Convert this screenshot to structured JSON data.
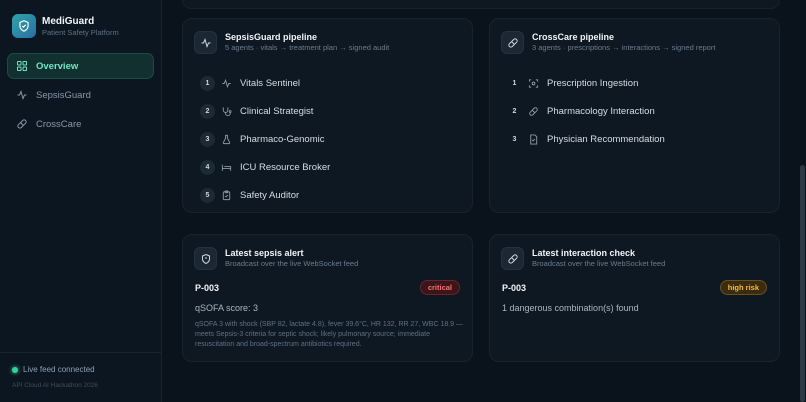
{
  "brand": {
    "name": "MediGuard",
    "subtitle": "Patient Safety Platform"
  },
  "nav": [
    {
      "label": "Overview",
      "icon": "grid-icon",
      "active": true
    },
    {
      "label": "SepsisGuard",
      "icon": "pulse-icon",
      "active": false
    },
    {
      "label": "CrossCare",
      "icon": "pill-icon",
      "active": false
    }
  ],
  "status": {
    "live": "Live feed connected",
    "footer": "API Cloud AI Hackathon 2026"
  },
  "sepsis_pipeline": {
    "title": "SepsisGuard pipeline",
    "subtitle": "5 agents · vitals → treatment plan → signed audit",
    "agents": [
      {
        "num": "1",
        "label": "Vitals Sentinel",
        "icon": "pulse-icon"
      },
      {
        "num": "2",
        "label": "Clinical Strategist",
        "icon": "stethoscope-icon"
      },
      {
        "num": "3",
        "label": "Pharmaco-Genomic",
        "icon": "flask-icon"
      },
      {
        "num": "4",
        "label": "ICU Resource Broker",
        "icon": "bed-icon"
      },
      {
        "num": "5",
        "label": "Safety Auditor",
        "icon": "clipboard-icon"
      }
    ]
  },
  "crosscare_pipeline": {
    "title": "CrossCare pipeline",
    "subtitle": "3 agents · prescriptions → interactions → signed report",
    "agents": [
      {
        "num": "1",
        "label": "Prescription Ingestion",
        "icon": "scan-icon"
      },
      {
        "num": "2",
        "label": "Pharmacology Interaction",
        "icon": "pill-icon"
      },
      {
        "num": "3",
        "label": "Physician Recommendation",
        "icon": "document-icon"
      }
    ]
  },
  "sepsis_alert": {
    "title": "Latest sepsis alert",
    "subtitle": "Broadcast over the live WebSocket feed",
    "patient": "P-003",
    "badge": "critical",
    "score": "qSOFA score: 3",
    "detail": "qSOFA 3 with shock (SBP 82, lactate 4.8), fever 39.6°C, HR 132, RR 27, WBC 18.9 — meets Sepsis-3 criteria for septic shock; likely pulmonary source; immediate resuscitation and broad-spectrum antibiotics required."
  },
  "interaction_check": {
    "title": "Latest interaction check",
    "subtitle": "Broadcast over the live WebSocket feed",
    "patient": "P-003",
    "badge": "high risk",
    "summary": "1 dangerous combination(s) found"
  },
  "colors": {
    "accent": "#6ee7c9",
    "critical": "#f87171",
    "high_risk": "#fbbf24",
    "live": "#34d399"
  }
}
